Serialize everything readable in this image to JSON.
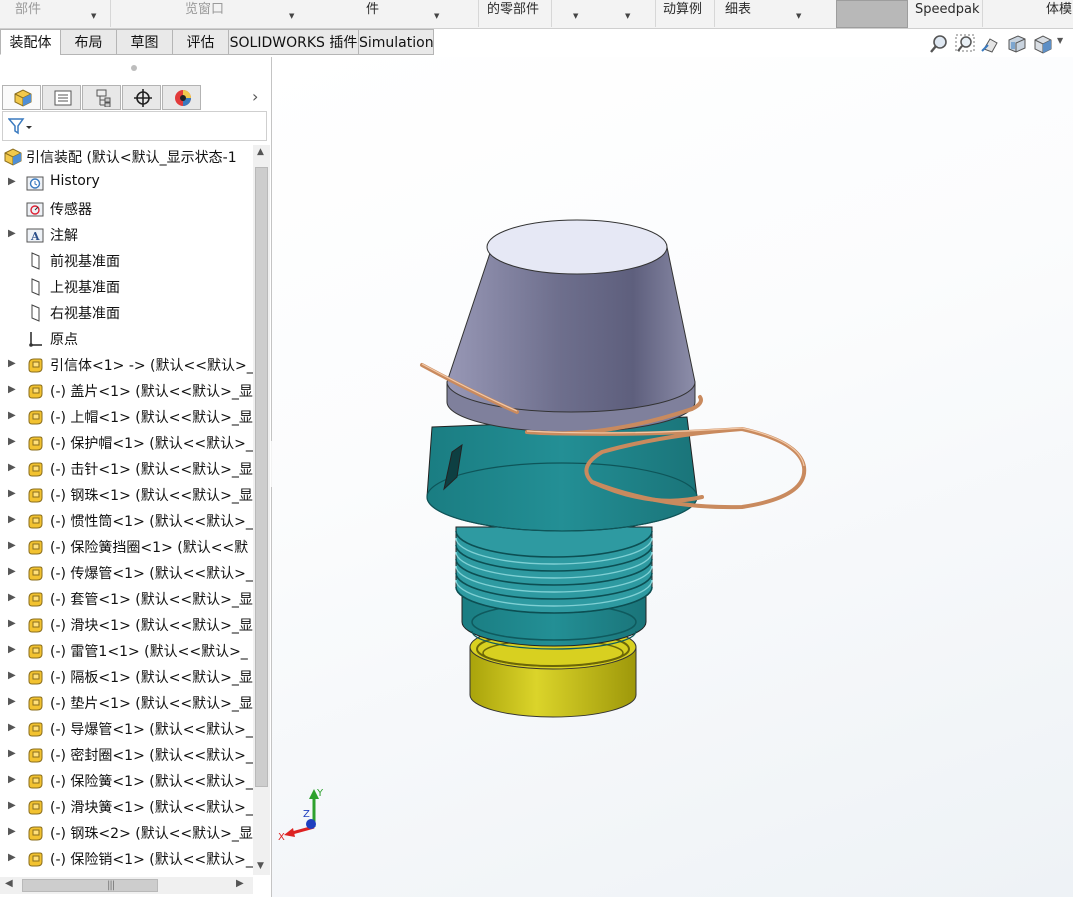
{
  "ribbon": {
    "items": [
      {
        "label": "部件",
        "dim": true
      },
      {
        "label": "览窗口",
        "dim": true
      },
      {
        "label": "件",
        "dim": false
      },
      {
        "label": "的零部件",
        "dim": false
      },
      {
        "label": "动算例",
        "dim": false
      },
      {
        "label": "细表",
        "dim": false
      },
      {
        "label": "Speedpak",
        "dim": false
      },
      {
        "label": "体模",
        "dim": false
      }
    ]
  },
  "tabs": [
    {
      "label": "装配体",
      "active": true
    },
    {
      "label": "布局",
      "active": false
    },
    {
      "label": "草图",
      "active": false
    },
    {
      "label": "评估",
      "active": false
    },
    {
      "label": "SOLIDWORKS 插件",
      "active": false
    },
    {
      "label": "Simulation",
      "active": false
    }
  ],
  "hud_icons": [
    "zoom-to-fit-icon",
    "zoom-to-area-icon",
    "previous-view-icon",
    "section-view-icon",
    "view-orientation-icon"
  ],
  "panel_tabs": [
    "featuremanager-tree-icon",
    "propertymanager-icon",
    "configurationmanager-icon",
    "dimxpertmanager-icon",
    "displaymanager-icon"
  ],
  "tree": {
    "root": "引信装配 (默认<默认_显示状态-1",
    "items": [
      {
        "label": "History",
        "icon": "history-folder",
        "expand": true
      },
      {
        "label": "传感器",
        "icon": "sensor-folder",
        "expand": false
      },
      {
        "label": "注解",
        "icon": "annotation-folder",
        "expand": true
      },
      {
        "label": "前视基准面",
        "icon": "plane",
        "expand": false
      },
      {
        "label": "上视基准面",
        "icon": "plane",
        "expand": false
      },
      {
        "label": "右视基准面",
        "icon": "plane",
        "expand": false
      },
      {
        "label": "原点",
        "icon": "origin",
        "expand": false
      },
      {
        "label": "引信体<1> -> (默认<<默认>_",
        "icon": "part",
        "expand": true
      },
      {
        "label": "(-) 盖片<1> (默认<<默认>_显",
        "icon": "part",
        "expand": true
      },
      {
        "label": "(-) 上帽<1> (默认<<默认>_显",
        "icon": "part",
        "expand": true
      },
      {
        "label": "(-) 保护帽<1> (默认<<默认>_",
        "icon": "part",
        "expand": true
      },
      {
        "label": "(-) 击针<1> (默认<<默认>_显",
        "icon": "part",
        "expand": true
      },
      {
        "label": "(-) 钢珠<1> (默认<<默认>_显",
        "icon": "part",
        "expand": true
      },
      {
        "label": "(-) 惯性筒<1> (默认<<默认>_",
        "icon": "part",
        "expand": true
      },
      {
        "label": "(-) 保险簧挡圈<1> (默认<<默",
        "icon": "part",
        "expand": true
      },
      {
        "label": "(-) 传爆管<1> (默认<<默认>_",
        "icon": "part",
        "expand": true
      },
      {
        "label": "(-) 套管<1> (默认<<默认>_显",
        "icon": "part",
        "expand": true
      },
      {
        "label": "(-) 滑块<1> (默认<<默认>_显",
        "icon": "part",
        "expand": true
      },
      {
        "label": "(-) 雷管1<1> (默认<<默认>_",
        "icon": "part",
        "expand": true
      },
      {
        "label": "(-) 隔板<1> (默认<<默认>_显",
        "icon": "part",
        "expand": true
      },
      {
        "label": "(-) 垫片<1> (默认<<默认>_显",
        "icon": "part",
        "expand": true
      },
      {
        "label": "(-) 导爆管<1> (默认<<默认>_",
        "icon": "part",
        "expand": true
      },
      {
        "label": "(-) 密封圈<1> (默认<<默认>_",
        "icon": "part",
        "expand": true
      },
      {
        "label": "(-) 保险簧<1> (默认<<默认>_",
        "icon": "part",
        "expand": true
      },
      {
        "label": "(-) 滑块簧<1> (默认<<默认>_",
        "icon": "part",
        "expand": true
      },
      {
        "label": "(-) 钢珠<2> (默认<<默认>_显",
        "icon": "part",
        "expand": true
      },
      {
        "label": "(-) 保险销<1> (默认<<默认>_",
        "icon": "part",
        "expand": true
      }
    ]
  },
  "triad": {
    "x": "X",
    "y": "Y",
    "z": "Z"
  },
  "colors": {
    "cap_top": "#e6e8f5",
    "cap_body": "#7e7f9c",
    "body_teal": "#1f8c91",
    "thread_teal": "#3aa4ab",
    "base_yellow": "#c9c313",
    "wire": "#c98a5e"
  }
}
